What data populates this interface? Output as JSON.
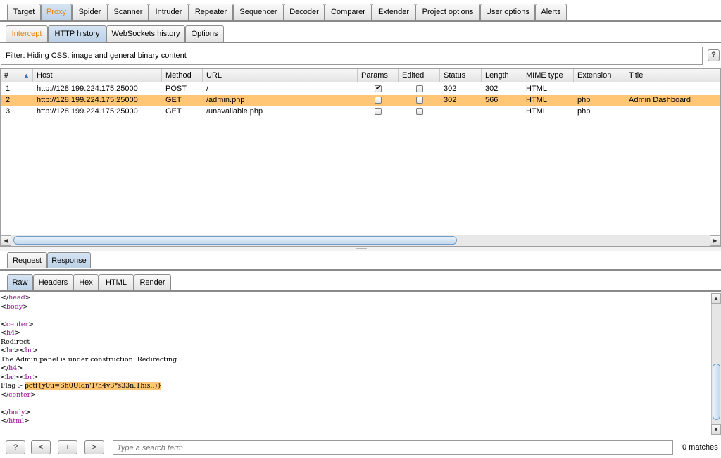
{
  "main_tabs": [
    "Target",
    "Proxy",
    "Spider",
    "Scanner",
    "Intruder",
    "Repeater",
    "Sequencer",
    "Decoder",
    "Comparer",
    "Extender",
    "Project options",
    "User options",
    "Alerts"
  ],
  "proxy_tabs": [
    "Intercept",
    "HTTP history",
    "WebSockets history",
    "Options"
  ],
  "filter_text": "Filter: Hiding CSS, image and general binary content",
  "help_label": "?",
  "columns": [
    "#",
    "Host",
    "Method",
    "URL",
    "Params",
    "Edited",
    "Status",
    "Length",
    "MIME type",
    "Extension",
    "Title"
  ],
  "sort_indicator": "▲",
  "rows": [
    {
      "num": "1",
      "host": "http://128.199.224.175:25000",
      "method": "POST",
      "url": "/",
      "params": "✔",
      "edited": "",
      "status": "302",
      "length": "302",
      "mime": "HTML",
      "ext": "",
      "title": ""
    },
    {
      "num": "2",
      "host": "http://128.199.224.175:25000",
      "method": "GET",
      "url": "/admin.php",
      "params": "",
      "edited": "",
      "status": "302",
      "length": "566",
      "mime": "HTML",
      "ext": "php",
      "title": "Admin Dashboard"
    },
    {
      "num": "3",
      "host": "http://128.199.224.175:25000",
      "method": "GET",
      "url": "/unavailable.php",
      "params": "",
      "edited": "",
      "status": "",
      "length": "",
      "mime": "HTML",
      "ext": "php",
      "title": ""
    }
  ],
  "message_tabs": [
    "Request",
    "Response"
  ],
  "view_tabs": [
    "Raw",
    "Headers",
    "Hex",
    "HTML",
    "Render"
  ],
  "response_lines": [
    {
      "parts": [
        [
          "t",
          "</"
        ],
        [
          "t",
          "head"
        ],
        [
          "t",
          ">"
        ]
      ]
    },
    {
      "parts": [
        [
          "t",
          "<"
        ],
        [
          "t",
          "body"
        ],
        [
          "t",
          ">"
        ]
      ]
    },
    {
      "parts": []
    },
    {
      "parts": [
        [
          "t",
          "<"
        ],
        [
          "t",
          "center"
        ],
        [
          "t",
          ">"
        ]
      ]
    },
    {
      "parts": [
        [
          "t",
          "<"
        ],
        [
          "t",
          "h4"
        ],
        [
          "t",
          ">"
        ]
      ]
    },
    {
      "parts": [
        [
          "p",
          "Redirect"
        ]
      ]
    },
    {
      "parts": [
        [
          "t",
          "<"
        ],
        [
          "t",
          "br"
        ],
        [
          "t",
          ">"
        ],
        [
          "t",
          "<"
        ],
        [
          "t",
          "br"
        ],
        [
          "t",
          ">"
        ]
      ]
    },
    {
      "parts": [
        [
          "p",
          "The Admin panel is under construction. Redirecting ..."
        ]
      ]
    },
    {
      "parts": [
        [
          "t",
          "</"
        ],
        [
          "t",
          "h4"
        ],
        [
          "t",
          ">"
        ]
      ]
    },
    {
      "parts": [
        [
          "t",
          "<"
        ],
        [
          "t",
          "br"
        ],
        [
          "t",
          ">"
        ],
        [
          "t",
          "<"
        ],
        [
          "t",
          "br"
        ],
        [
          "t",
          ">"
        ]
      ]
    },
    {
      "parts": [
        [
          "p",
          "Flag :- "
        ],
        [
          "h",
          "pctf{y0u=Sh0Uldn'1/h4v3*s33n,1his.:)}"
        ]
      ]
    },
    {
      "parts": [
        [
          "t",
          "</"
        ],
        [
          "t",
          "center"
        ],
        [
          "t",
          ">"
        ]
      ]
    },
    {
      "parts": []
    },
    {
      "parts": [
        [
          "t",
          "</"
        ],
        [
          "t",
          "body"
        ],
        [
          "t",
          ">"
        ]
      ]
    },
    {
      "parts": [
        [
          "t",
          "</"
        ],
        [
          "t",
          "html"
        ],
        [
          "t",
          ">"
        ]
      ]
    }
  ],
  "bottom_buttons": [
    "?",
    "<",
    "+",
    ">"
  ],
  "search_placeholder": "Type a search term",
  "matches_text": "0 matches",
  "colors": {
    "active_tab_text": "#e8820c",
    "selected_row": "#ffc675",
    "tag_color": "#9b0e96"
  }
}
